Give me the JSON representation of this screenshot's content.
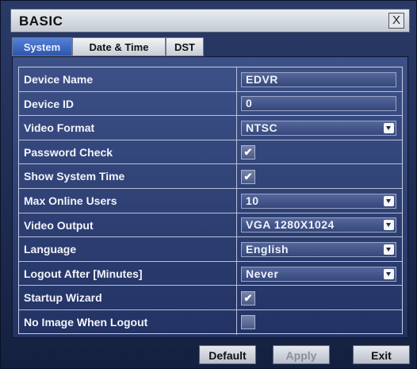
{
  "window": {
    "title": "BASIC",
    "close_label": "X"
  },
  "tabs": [
    {
      "label": "System",
      "active": true
    },
    {
      "label": "Date & Time",
      "active": false
    },
    {
      "label": "DST",
      "active": false
    }
  ],
  "settings": [
    {
      "label": "Device Name",
      "type": "text",
      "value": "EDVR"
    },
    {
      "label": "Device ID",
      "type": "text",
      "value": "0"
    },
    {
      "label": "Video Format",
      "type": "select",
      "value": "NTSC"
    },
    {
      "label": "Password Check",
      "type": "checkbox",
      "checked": true
    },
    {
      "label": "Show System Time",
      "type": "checkbox",
      "checked": true
    },
    {
      "label": "Max Online Users",
      "type": "select",
      "value": "10"
    },
    {
      "label": "Video Output",
      "type": "select",
      "value": "VGA 1280X1024"
    },
    {
      "label": "Language",
      "type": "select",
      "value": "English"
    },
    {
      "label": "Logout After [Minutes]",
      "type": "select",
      "value": "Never"
    },
    {
      "label": "Startup Wizard",
      "type": "checkbox",
      "checked": true
    },
    {
      "label": "No Image When Logout",
      "type": "checkbox",
      "checked": false
    }
  ],
  "buttons": {
    "default": "Default",
    "apply": "Apply",
    "exit": "Exit"
  },
  "colors": {
    "accent": "#2d56ae",
    "window_bg": "#1d2b4f",
    "panel_bg": "#2e4075"
  }
}
